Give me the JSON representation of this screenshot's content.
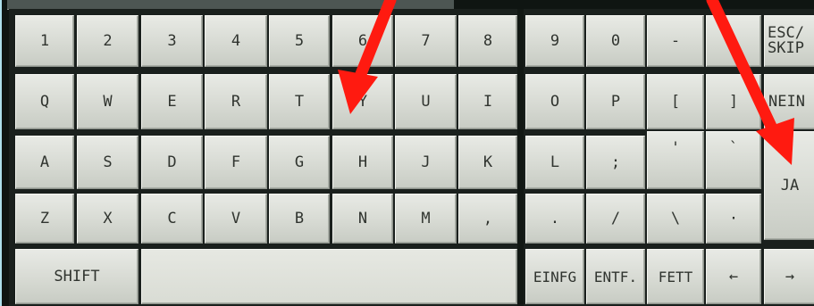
{
  "keyboard": {
    "row1": [
      "1",
      "2",
      "3",
      "4",
      "5",
      "6",
      "7",
      "8",
      "9",
      "0",
      "-",
      "",
      "ESC/\nSKIP"
    ],
    "row2": [
      "Q",
      "W",
      "E",
      "R",
      "T",
      "Y",
      "U",
      "I",
      "O",
      "P",
      "[",
      "]",
      "NEIN"
    ],
    "row3": [
      "A",
      "S",
      "D",
      "F",
      "G",
      "H",
      "J",
      "K",
      "L",
      ";",
      "'",
      "`",
      "JA"
    ],
    "row4": [
      "Z",
      "X",
      "C",
      "V",
      "B",
      "N",
      "M",
      ",",
      ".",
      "/",
      "\\",
      "·"
    ],
    "row5": [
      "SHIFT",
      "",
      "EINFG",
      "ENTF.",
      "FETT",
      "←",
      "→"
    ]
  },
  "colors": {
    "arrow": "#ff1a10",
    "background": "#aee0ec",
    "key": "#d9dcd5"
  }
}
